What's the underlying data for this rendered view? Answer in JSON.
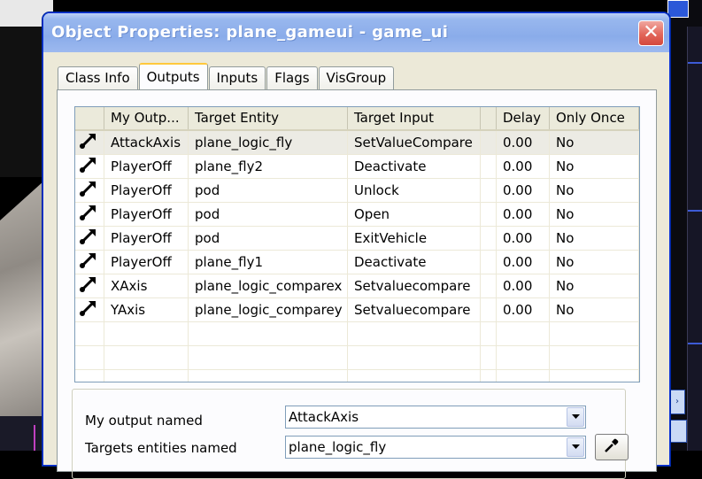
{
  "window": {
    "title": "Object Properties: plane_gameui - game_ui",
    "close_icon": "close-icon"
  },
  "tabs": [
    {
      "label": "Class Info",
      "active": false
    },
    {
      "label": "Outputs",
      "active": true
    },
    {
      "label": "Inputs",
      "active": false
    },
    {
      "label": "Flags",
      "active": false
    },
    {
      "label": "VisGroup",
      "active": false
    }
  ],
  "outputs_list": {
    "columns": [
      "My Outp...",
      "Target Entity",
      "Target Input",
      "Delay",
      "Only Once"
    ],
    "row_icon": "output-connection-icon",
    "rows": [
      {
        "output": "AttackAxis",
        "target_entity": "plane_logic_fly",
        "target_input": "SetValueCompare",
        "delay": "0.00",
        "only_once": "No",
        "selected": true
      },
      {
        "output": "PlayerOff",
        "target_entity": "plane_fly2",
        "target_input": "Deactivate",
        "delay": "0.00",
        "only_once": "No",
        "selected": false
      },
      {
        "output": "PlayerOff",
        "target_entity": "pod",
        "target_input": "Unlock",
        "delay": "0.00",
        "only_once": "No",
        "selected": false
      },
      {
        "output": "PlayerOff",
        "target_entity": "pod",
        "target_input": "Open",
        "delay": "0.00",
        "only_once": "No",
        "selected": false
      },
      {
        "output": "PlayerOff",
        "target_entity": "pod",
        "target_input": "ExitVehicle",
        "delay": "0.00",
        "only_once": "No",
        "selected": false
      },
      {
        "output": "PlayerOff",
        "target_entity": "plane_fly1",
        "target_input": "Deactivate",
        "delay": "0.00",
        "only_once": "No",
        "selected": false
      },
      {
        "output": "XAxis",
        "target_entity": "plane_logic_comparex",
        "target_input": "Setvaluecompare",
        "delay": "0.00",
        "only_once": "No",
        "selected": false
      },
      {
        "output": "YAxis",
        "target_entity": "plane_logic_comparey",
        "target_input": "Setvaluecompare",
        "delay": "0.00",
        "only_once": "No",
        "selected": false
      }
    ]
  },
  "edit_panel": {
    "output_label": "My output named",
    "output_value": "AttackAxis",
    "target_label": "Targets entities named",
    "target_value": "plane_logic_fly",
    "picker_icon": "eyedropper-icon"
  },
  "colors": {
    "titlebar": "#8aacea",
    "selected_row": "#ecebe4",
    "active_tab_accent": "#ffc83c",
    "close_button": "#e2665a"
  }
}
